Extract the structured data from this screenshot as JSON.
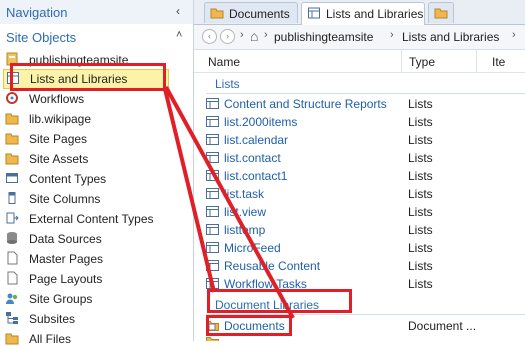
{
  "navigation": {
    "title": "Navigation",
    "collapse_glyph": "‹",
    "section_title": "Site Objects",
    "section_glyph": "˄",
    "items": [
      {
        "label": "publishingteamsite",
        "icon": "site-icon"
      },
      {
        "label": "Lists and Libraries",
        "icon": "list-icon",
        "selected": true
      },
      {
        "label": "Workflows",
        "icon": "workflow-icon"
      },
      {
        "label": "lib.wikipage",
        "icon": "folder-icon"
      },
      {
        "label": "Site Pages",
        "icon": "folder-icon"
      },
      {
        "label": "Site Assets",
        "icon": "folder-icon"
      },
      {
        "label": "Content Types",
        "icon": "content-types-icon"
      },
      {
        "label": "Site Columns",
        "icon": "site-columns-icon"
      },
      {
        "label": "External Content Types",
        "icon": "external-content-icon"
      },
      {
        "label": "Data Sources",
        "icon": "database-icon"
      },
      {
        "label": "Master Pages",
        "icon": "page-icon"
      },
      {
        "label": "Page Layouts",
        "icon": "page-icon"
      },
      {
        "label": "Site Groups",
        "icon": "users-icon"
      },
      {
        "label": "Subsites",
        "icon": "subsites-icon"
      },
      {
        "label": "All Files",
        "icon": "files-icon"
      }
    ]
  },
  "tabs": [
    {
      "label": "Documents",
      "active": false
    },
    {
      "label": "Lists and Libraries",
      "active": true
    },
    {
      "label": "",
      "active": false
    }
  ],
  "breadcrumb": {
    "back": "‹",
    "forward": "›",
    "home_glyph": "⌂",
    "items": [
      "publishingteamsite",
      "Lists and Libraries"
    ],
    "separator": "›"
  },
  "columns": {
    "name": "Name",
    "type": "Type",
    "extra": "Ite"
  },
  "groups": {
    "lists": {
      "label": "Lists",
      "rows": [
        {
          "name": "Content and Structure Reports",
          "type": "Lists"
        },
        {
          "name": "list.2000items",
          "type": "Lists"
        },
        {
          "name": "list.calendar",
          "type": "Lists"
        },
        {
          "name": "list.contact",
          "type": "Lists"
        },
        {
          "name": "list.contact1",
          "type": "Lists"
        },
        {
          "name": "list.task",
          "type": "Lists"
        },
        {
          "name": "list.view",
          "type": "Lists"
        },
        {
          "name": "listtemp",
          "type": "Lists"
        },
        {
          "name": "MicroFeed",
          "type": "Lists"
        },
        {
          "name": "Reusable Content",
          "type": "Lists"
        },
        {
          "name": "Workflow Tasks",
          "type": "Lists"
        }
      ]
    },
    "libraries": {
      "label": "Document Libraries",
      "rows": [
        {
          "name": "Documents",
          "type": "Document ..."
        }
      ]
    }
  },
  "colors": {
    "accent": "#2b6cb5",
    "annotation": "#e01f26",
    "selection": "#fdf3a8"
  }
}
